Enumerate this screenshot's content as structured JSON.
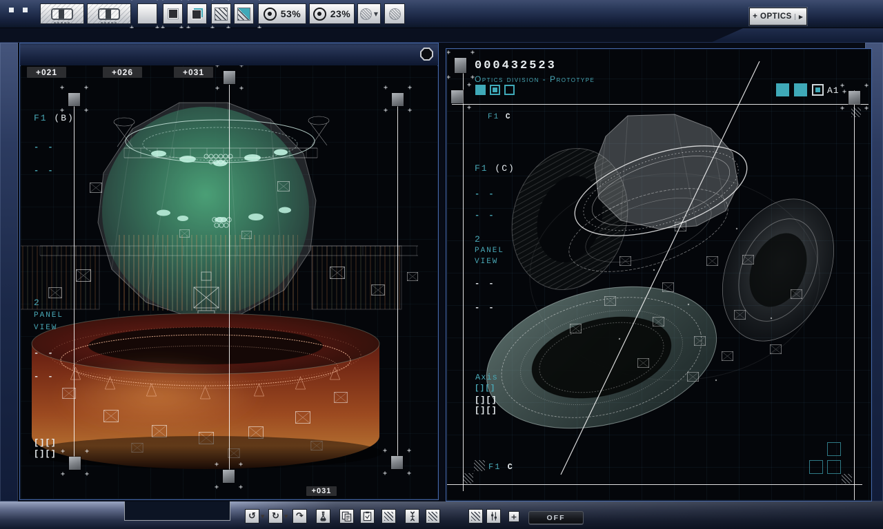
{
  "colors": {
    "accent_teal": "#3fa9b8",
    "panel_border": "#4568a8",
    "dome_green": "#2e8a5f",
    "ring_orange": "#9c4a20"
  },
  "icons": {
    "undo": "↺",
    "redo": "↻",
    "redo_alt": "↷",
    "caret_down": "▼",
    "arrow_right": "▶",
    "plus": "+"
  },
  "toolbar": {
    "zoom_a": "53%",
    "zoom_b": "23%",
    "optics_label": "+ OPTICS"
  },
  "left_panel": {
    "markers": [
      "+021",
      "+026",
      "+031"
    ],
    "marker_bottom": "+031",
    "f1_label": "F1",
    "f1_code": "(B)",
    "dashes_teal": [
      "- -",
      "- -"
    ],
    "view_lines": [
      "2",
      "PANEL",
      "VIEW"
    ],
    "dashes_white": [
      "- -",
      "- -"
    ],
    "brackets": [
      "[][]",
      "[][]"
    ]
  },
  "right_panel": {
    "serial": "000432523",
    "subtitle": "Optics division - Prototype",
    "sector": "A1",
    "f1_label": "F1",
    "f1_top_code": "C",
    "f1_mid_code": "(C)",
    "dashes_teal": [
      "- -",
      "- -"
    ],
    "view_lines": [
      "2",
      "PANEL",
      "VIEW"
    ],
    "dashes_white": [
      "- -",
      "- -"
    ],
    "axis_label": "Axis",
    "axis_brackets": [
      "[][]",
      "[][]",
      "[][]"
    ],
    "f1_bottom_code": "C"
  },
  "bottom_bar": {
    "off_label": "OFF"
  }
}
